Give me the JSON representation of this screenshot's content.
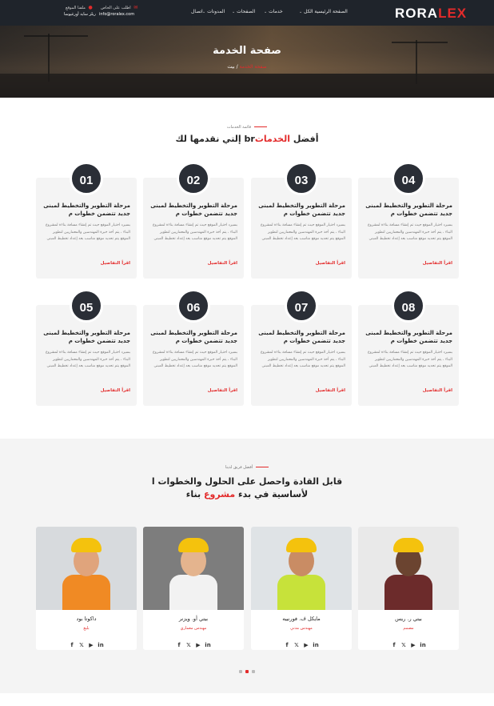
{
  "header": {
    "logo_main": "RORA",
    "logo_accent": "LEX",
    "nav": [
      {
        "label": "الصفحة الرئيسية الكل",
        "has_dropdown": true
      },
      {
        "label": "خدمات",
        "has_dropdown": true
      },
      {
        "label": "الصفحات",
        "has_dropdown": true
      },
      {
        "label": "المدونات",
        "has_dropdown": true
      },
      {
        "label": "اتصال",
        "has_dropdown": false
      }
    ],
    "contact": {
      "email_label": "اطلب على الخاص",
      "email": "info@roralex.com",
      "location_label": "ملفنا الموقع",
      "location": "ريلز سايد أورغيوسا"
    }
  },
  "hero": {
    "title": "صفحة الخدمة",
    "breadcrumb_home": "بيت",
    "breadcrumb_sep": "/",
    "breadcrumb_current": "صفحة الخدمة"
  },
  "services": {
    "eyebrow": "قائمة الخدمات",
    "title_prefix": "إلتي نقدمها لك brأفضل ",
    "title_highlight": "الخدمات",
    "cards": [
      {
        "number": "04",
        "title": "مرحلة التطوير والتخطيط لمبنى جديد تتضمن خطوات م",
        "text": "بسيرد اختيار الموقع حيث تم إنشاء مسافة بناءة لمشروع البناء ، يتم أخذ خبرة المهندسين والمعماريين لتطوير الموقع يتم تحديد موقع مناسب بعد إعداد تخطيط المبنى",
        "link": "اقرأ التفاصيل"
      },
      {
        "number": "03",
        "title": "مرحلة التطوير والتخطيط لمبنى جديد تتضمن خطوات م",
        "text": "بسيرد اختيار الموقع حيث تم إنشاء مسافة بناءة لمشروع البناء ، يتم أخذ خبرة المهندسين والمعماريين لتطوير الموقع يتم تحديد موقع مناسب بعد إعداد تخطيط المبنى",
        "link": "اقرأ التفاصيل"
      },
      {
        "number": "02",
        "title": "مرحلة التطوير والتخطيط لمبنى جديد تتضمن خطوات م",
        "text": "بسيرد اختيار الموقع حيث تم إنشاء مسافة بناءة لمشروع البناء ، يتم أخذ خبرة المهندسين والمعماريين لتطوير الموقع يتم تحديد موقع مناسب بعد إعداد تخطيط المبنى",
        "link": "اقرأ التفاصيل"
      },
      {
        "number": "01",
        "title": "مرحلة التطوير والتخطيط لمبنى جديد تتضمن خطوات م",
        "text": "بسيرد اختيار الموقع حيث تم إنشاء مسافة بناءة لمشروع البناء ، يتم أخذ خبرة المهندسين والمعماريين لتطوير الموقع يتم تحديد موقع مناسب بعد إعداد تخطيط المبنى",
        "link": "اقرأ التفاصيل"
      },
      {
        "number": "08",
        "title": "مرحلة التطوير والتخطيط لمبنى جديد تتضمن خطوات م",
        "text": "بسيرد اختيار الموقع حيث تم إنشاء مسافة بناءة لمشروع البناء ، يتم أخذ خبرة المهندسين والمعماريين لتطوير الموقع يتم تحديد موقع مناسب بعد إعداد تخطيط المبنى",
        "link": "اقرأ التفاصيل"
      },
      {
        "number": "07",
        "title": "مرحلة التطوير والتخطيط لمبنى جديد تتضمن خطوات م",
        "text": "بسيرد اختيار الموقع حيث تم إنشاء مسافة بناءة لمشروع البناء ، يتم أخذ خبرة المهندسين والمعماريين لتطوير الموقع يتم تحديد موقع مناسب بعد إعداد تخطيط المبنى",
        "link": "اقرأ التفاصيل"
      },
      {
        "number": "06",
        "title": "مرحلة التطوير والتخطيط لمبنى جديد تتضمن خطوات م",
        "text": "بسيرد اختيار الموقع حيث تم إنشاء مسافة بناءة لمشروع البناء ، يتم أخذ خبرة المهندسين والمعماريين لتطوير الموقع يتم تحديد موقع مناسب بعد إعداد تخطيط المبنى",
        "link": "اقرأ التفاصيل"
      },
      {
        "number": "05",
        "title": "مرحلة التطوير والتخطيط لمبنى جديد تتضمن خطوات م",
        "text": "بسيرد اختيار الموقع حيث تم إنشاء مسافة بناءة لمشروع البناء ، يتم أخذ خبرة المهندسين والمعماريين لتطوير الموقع يتم تحديد موقع مناسب بعد إعداد تخطيط المبنى",
        "link": "اقرأ التفاصيل"
      }
    ]
  },
  "team": {
    "eyebrow": "أفضل فريق لدينا",
    "title_line1": "قابل القادة واحصل على الحلول والخطوات ا",
    "title_line2_prefix": "لأساسية في بدء ",
    "title_line2_highlight": "مشروع",
    "title_line2_suffix": " بناء",
    "members": [
      {
        "name": "بيتي ر. ريس",
        "role": "مصمم"
      },
      {
        "name": "مايكل ف. فورنييه",
        "role": "مهندس مدني"
      },
      {
        "name": "بيتي أو. ويزنر",
        "role": "مهندس معماري"
      },
      {
        "name": "داكوتا بود",
        "role": "بليغ"
      }
    ],
    "social_icons": [
      "facebook-icon",
      "twitter-icon",
      "youtube-icon",
      "linkedin-icon"
    ],
    "carousel_dots": 3,
    "carousel_active": 2
  },
  "colors": {
    "accent": "#e32b2b",
    "dark": "#1f242b",
    "badge": "#2a2e36",
    "card_bg": "#f4f4f4",
    "helmet": "#f4c20d"
  }
}
